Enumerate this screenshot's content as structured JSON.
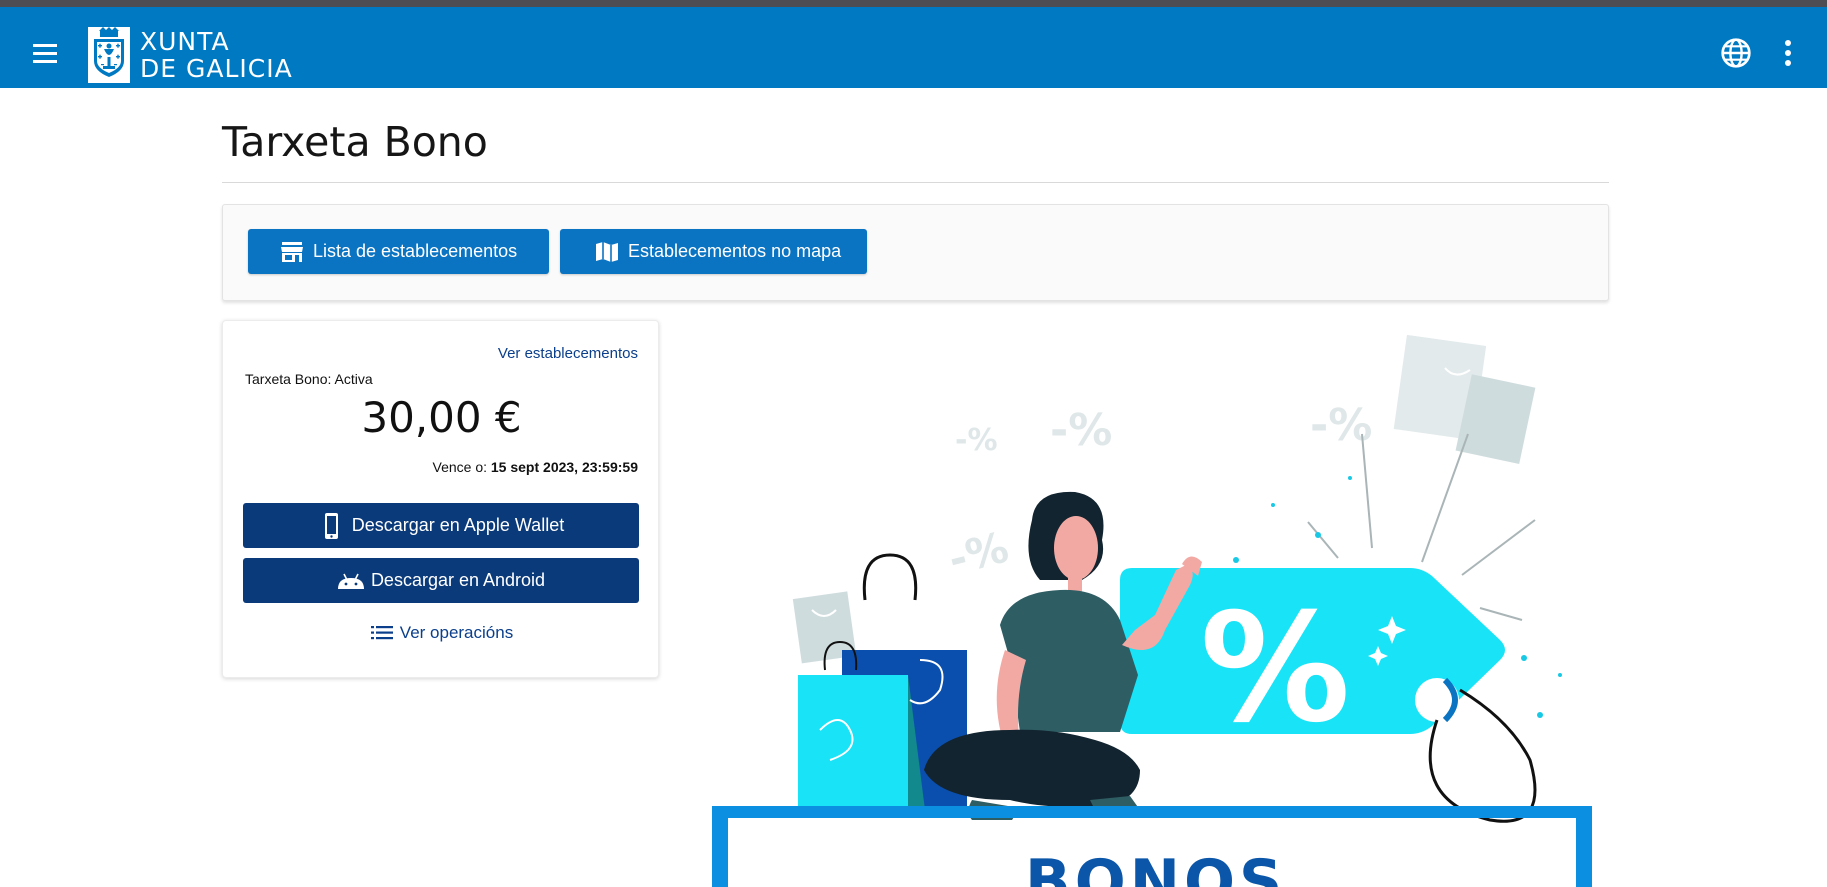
{
  "header": {
    "logo_line1": "XUNTA",
    "logo_line2": "DE GALICIA",
    "bar_color": "#0079c3"
  },
  "icons": {
    "menu": "hamburger-menu-icon",
    "language": "globe-icon",
    "more": "more-vert-icon",
    "store": "storefront-icon",
    "map": "map-icon",
    "phone": "smartphone-icon",
    "android": "android-icon",
    "list": "list-icon"
  },
  "page": {
    "title": "Tarxeta Bono"
  },
  "actions": {
    "list_label": "Lista de establecementos",
    "map_label": "Establecementos no mapa"
  },
  "card": {
    "link_label": "Ver establecementos",
    "status": "Tarxeta Bono: Activa",
    "amount": "30,00 €",
    "expiry_prefix": "Vence o: ",
    "expiry_value": "15 sept 2023, 23:59:59",
    "apple_label": "Descargar en Apple Wallet",
    "android_label": "Descargar en Android",
    "operations_label": "Ver operacións"
  },
  "banner": {
    "text": "BONOS",
    "sign_symbol": "%",
    "discount_text": "-%"
  },
  "colors": {
    "primary": "#0b74c2",
    "navy": "#0b3a7a",
    "link": "#0b3f8c",
    "tag_cyan": "#18e3f7"
  }
}
